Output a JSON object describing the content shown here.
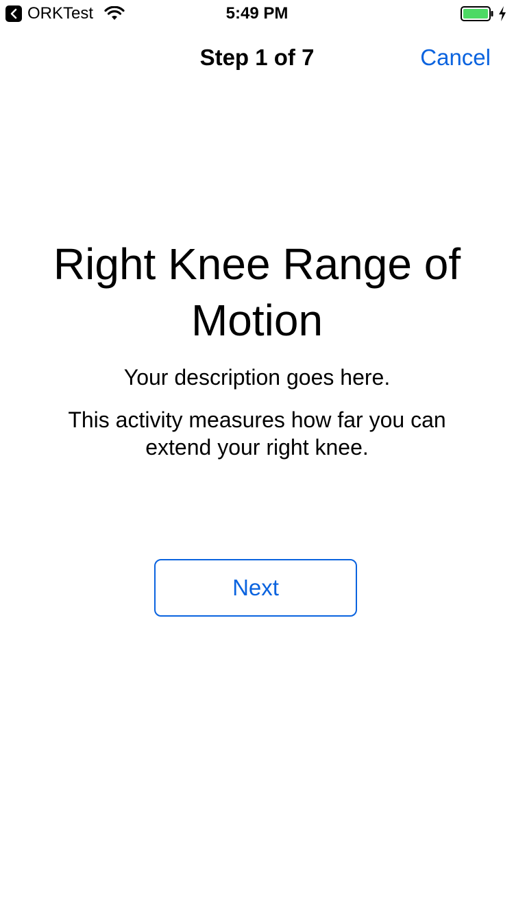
{
  "status_bar": {
    "back_app": "ORKTest",
    "time": "5:49 PM",
    "icons": {
      "back": "chevron-left-icon",
      "wifi": "wifi-icon",
      "battery": "battery-icon",
      "charging": "lightning-icon"
    },
    "battery_color": "#4cd964"
  },
  "nav": {
    "title": "Step 1 of 7",
    "cancel_label": "Cancel"
  },
  "content": {
    "title": "Right Knee Range of Motion",
    "description": "Your description goes here.",
    "detail": "This activity measures how far you can extend your right knee."
  },
  "actions": {
    "next_label": "Next"
  },
  "colors": {
    "accent": "#0a63df"
  }
}
